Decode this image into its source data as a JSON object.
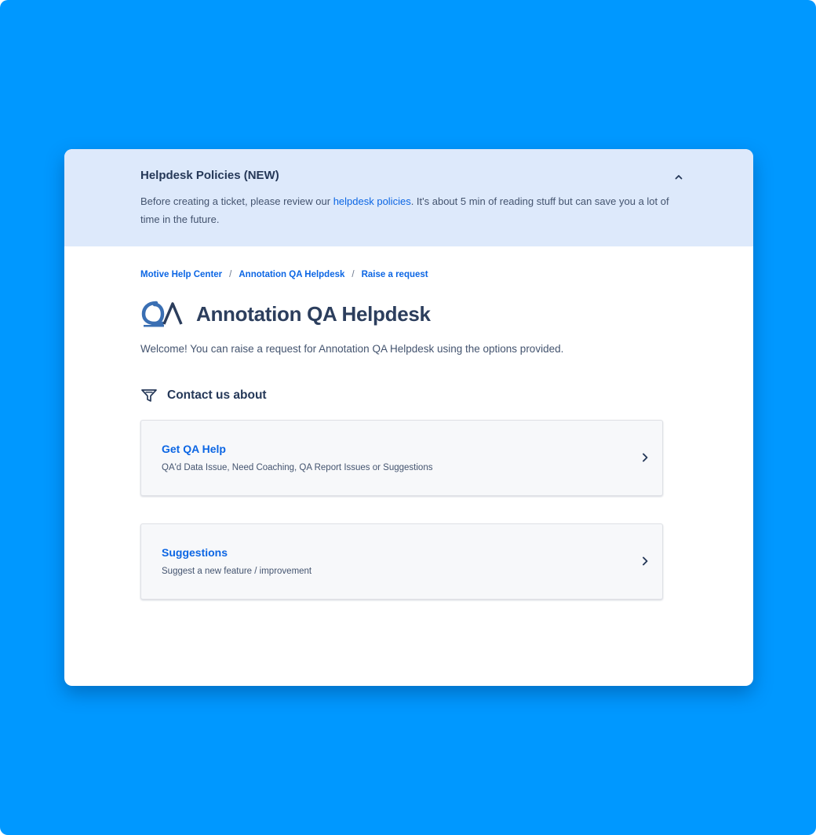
{
  "colors": {
    "background": "#0098ff",
    "banner": "#dde9fb",
    "link": "#0c66e4",
    "card": "#ffffff"
  },
  "banner": {
    "title": "Helpdesk Policies (NEW)",
    "text_before": "Before creating a ticket, please review our ",
    "link_text": "helpdesk policies",
    "text_after": ". It's about 5 min of reading stuff but can save you a lot of time in the future.",
    "collapse_icon": "chevron-up-icon"
  },
  "breadcrumb": {
    "items": [
      "Motive Help Center",
      "Annotation QA Helpdesk",
      "Raise a request"
    ],
    "separator": "/"
  },
  "header": {
    "logo_icon": "qa-logo-icon",
    "title": "Annotation QA Helpdesk"
  },
  "welcome": "Welcome! You can raise a request for Annotation QA Helpdesk using the options provided.",
  "contact": {
    "icon": "filter-icon",
    "label": "Contact us about"
  },
  "options": [
    {
      "title": "Get QA Help",
      "description": "QA'd Data Issue, Need Coaching, QA Report Issues or Suggestions",
      "icon": "chevron-right-icon"
    },
    {
      "title": "Suggestions",
      "description": "Suggest a new feature / improvement",
      "icon": "chevron-right-icon"
    }
  ]
}
